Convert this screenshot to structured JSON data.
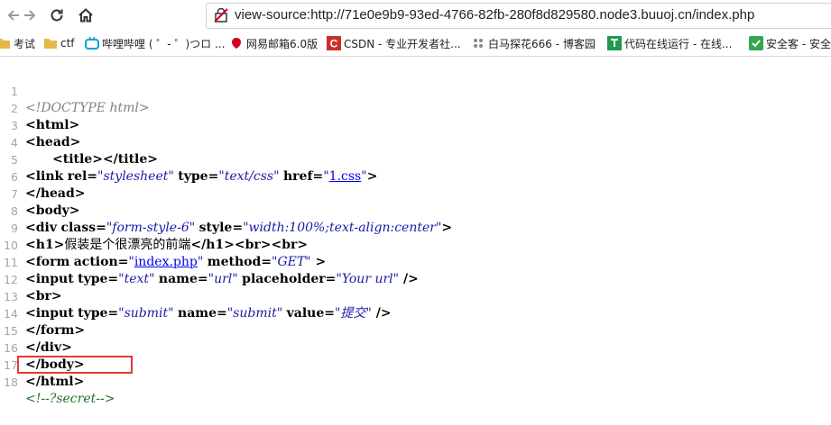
{
  "toolbar": {
    "url_prefix": "view-source:",
    "url": "http://71e0e9b9-93ed-4766-82fb-280f8d829580.node3.buuoj.cn/index.php"
  },
  "bookmarks": [
    {
      "label": "考试",
      "icon": "folder-icon",
      "color": "#e6b84a"
    },
    {
      "label": "ctf",
      "icon": "folder-icon",
      "color": "#e6b84a"
    },
    {
      "label": "哔哩哔哩 ( ゜- ゜)つロ ...",
      "icon": "bilibili-icon",
      "color": "#00a1d6"
    },
    {
      "label": "网易邮箱6.0版",
      "icon": "netease-mail-icon",
      "color": "#d0021b"
    },
    {
      "label": "CSDN - 专业开发者社...",
      "icon": "csdn-icon",
      "color": "#c9302c"
    },
    {
      "label": "白马探花666 - 博客园",
      "icon": "cnblogs-icon",
      "color": "#888888"
    },
    {
      "label": "代码在线运行 - 在线...",
      "icon": "runcode-icon",
      "color": "#1e9b4f"
    },
    {
      "label": "安全客 - 安全",
      "icon": "anquanke-icon",
      "color": "#2fa84f"
    }
  ],
  "source": {
    "line_numbers": [
      "1",
      "2",
      "3",
      "4",
      "5",
      "6",
      "7",
      "8",
      "9",
      "10",
      "11",
      "12",
      "13",
      "14",
      "15",
      "16",
      "17",
      "18"
    ],
    "doctype": "<!DOCTYPE html>",
    "html_open": "<html>",
    "head_open": "<head>",
    "title_open": "<title>",
    "title_close": "</title>",
    "link_open": "<link",
    "attr_rel": "rel=",
    "val_stylesheet": "\"stylesheet\"",
    "attr_type": "type=",
    "val_textcss": "\"text/css\"",
    "attr_href": "href=",
    "quote": "\"",
    "link_css": "1.css",
    "tag_end": ">",
    "head_close": "</head>",
    "body_open": "<body>",
    "div_open": "<div",
    "attr_class": "class=",
    "val_class": "\"form-style-6\"",
    "attr_style": "style=",
    "val_style": "\"width:100%;text-align:center\"",
    "h1_open": "<h1>",
    "h1_text": "假装是个很漂亮的前端",
    "h1_close": "</h1>",
    "br": "<br>",
    "form_open": "<form",
    "attr_action": "action=",
    "link_index": "index.php",
    "attr_method": "method=",
    "val_get": "\"GET\"",
    "tag_end_spaced": " >",
    "input_open": "<input",
    "val_text": "\"text\"",
    "attr_name": "name=",
    "val_url": "\"url\"",
    "attr_placeholder": "placeholder=",
    "val_placeholder": "\"Your url\"",
    "self_close": " />",
    "val_submit": "\"submit\"",
    "attr_value": "value=",
    "val_tijiao": "\"提交\"",
    "form_close": "</form>",
    "div_close": "</div>",
    "body_close": "</body>",
    "html_close": "</html>",
    "secret_comment": "<!--?secret-->"
  },
  "colors": {
    "highlight_box": "#e53935",
    "comment": "#236e25",
    "attribute_value": "#1a1aa6",
    "link": "#0000ee"
  }
}
